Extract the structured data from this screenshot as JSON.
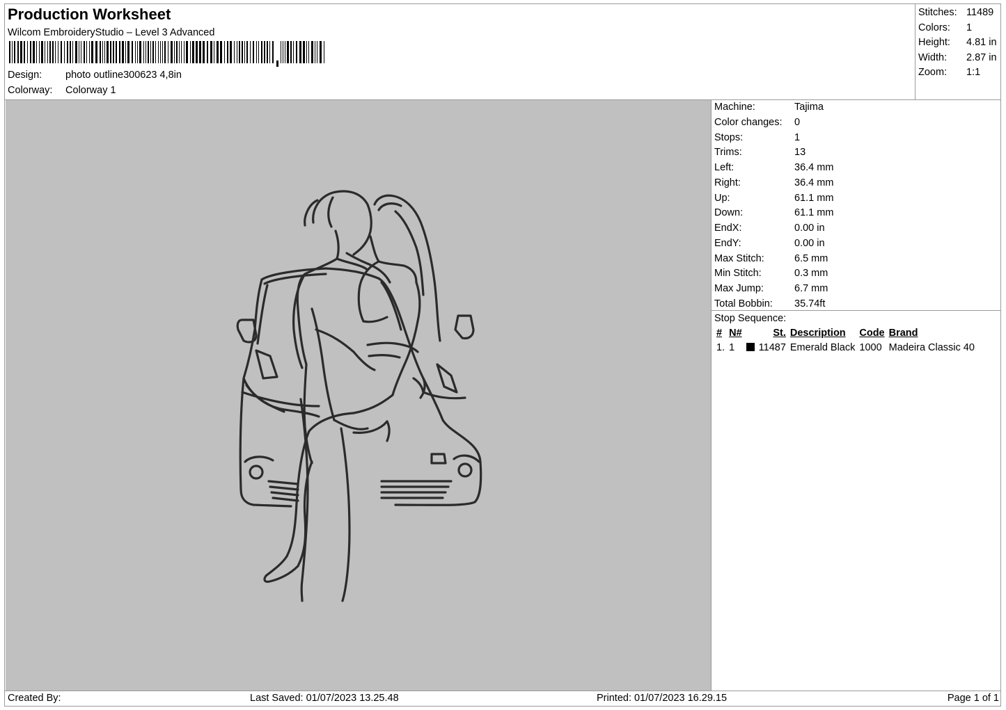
{
  "header": {
    "title": "Production Worksheet",
    "subtitle": "Wilcom EmbroideryStudio – Level 3 Advanced",
    "design_label": "Design:",
    "design_value": "photo outline300623 4,8in",
    "colorway_label": "Colorway:",
    "colorway_value": "Colorway 1"
  },
  "summary": {
    "stitches_label": "Stitches:",
    "stitches_value": "11489",
    "colors_label": "Colors:",
    "colors_value": "1",
    "height_label": "Height:",
    "height_value": "4.81 in",
    "width_label": "Width:",
    "width_value": "2.87 in",
    "zoom_label": "Zoom:",
    "zoom_value": "1:1"
  },
  "machine_info": {
    "machine_label": "Machine:",
    "machine_value": "Tajima",
    "color_changes_label": "Color changes:",
    "color_changes_value": "0",
    "stops_label": "Stops:",
    "stops_value": "1",
    "trims_label": "Trims:",
    "trims_value": "13",
    "left_label": "Left:",
    "left_value": "36.4 mm",
    "right_label": "Right:",
    "right_value": "36.4 mm",
    "up_label": "Up:",
    "up_value": "61.1 mm",
    "down_label": "Down:",
    "down_value": "61.1 mm",
    "endx_label": "EndX:",
    "endx_value": "0.00 in",
    "endy_label": "EndY:",
    "endy_value": "0.00 in",
    "max_stitch_label": "Max Stitch:",
    "max_stitch_value": "6.5 mm",
    "min_stitch_label": "Min Stitch:",
    "min_stitch_value": "0.3 mm",
    "max_jump_label": "Max Jump:",
    "max_jump_value": "6.7 mm",
    "total_bobbin_label": "Total Bobbin:",
    "total_bobbin_value": "35.74ft"
  },
  "stop_sequence": {
    "label": "Stop Sequence:",
    "columns": {
      "num": "#",
      "needle": "N#",
      "stitches": "St.",
      "description": "Description",
      "code": "Code",
      "brand": "Brand"
    },
    "rows": [
      {
        "num": "1.",
        "needle": "1",
        "swatch_color": "#000000",
        "stitches": "11487",
        "description": "Emerald Black",
        "code": "1000",
        "brand": "Madeira Classic 40"
      }
    ]
  },
  "footer": {
    "created_by": "Created By:",
    "last_saved": "Last Saved: 01/07/2023 13.25.48",
    "printed": "Printed: 01/07/2023 16.29.15",
    "page": "Page 1 of 1"
  },
  "colors": {
    "canvas_bg": "#c0c0c0",
    "thread": "#2b2b2b",
    "border": "#9a9a9a"
  }
}
